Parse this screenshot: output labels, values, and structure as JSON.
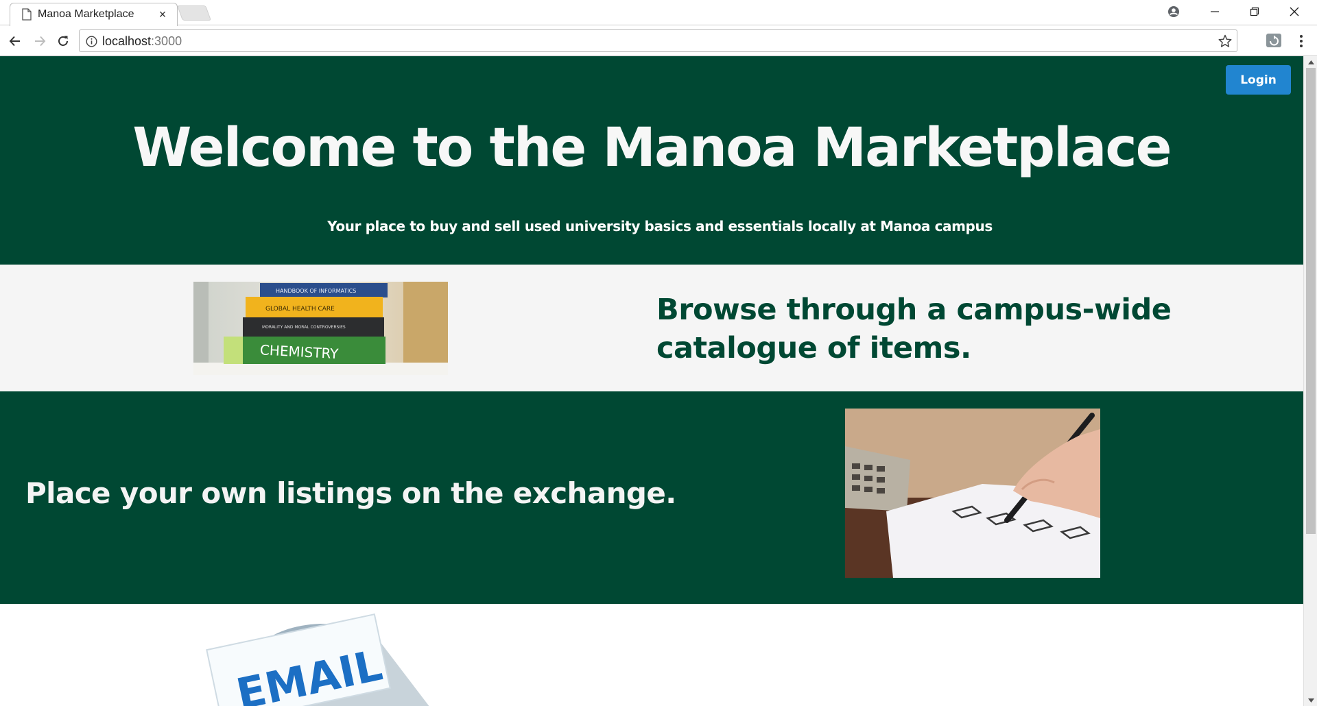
{
  "browser": {
    "tab_title": "Manoa Marketplace",
    "tab_close": "×",
    "url_host": "localhost",
    "url_port": ":3000"
  },
  "page": {
    "login_label": "Login",
    "hero_title": "Welcome to the Manoa Marketplace",
    "hero_subtitle": "Your place to buy and sell used university basics and essentials locally at Manoa campus",
    "browse_heading": "Browse through a campus-wide catalogue of items.",
    "listing_heading": "Place your own listings on the exchange.",
    "books_image": {
      "spines": [
        "HANDBOOK OF INFORMATICS",
        "GLOBAL HEALTH CARE",
        "MORALITY AND MORAL CONTROVERSIES",
        "CHEMISTRY"
      ]
    },
    "email_image": {
      "text": "EMAIL"
    }
  },
  "colors": {
    "primary_green": "#004833",
    "login_blue": "#2185d0",
    "light_band": "#f5f5f5"
  }
}
